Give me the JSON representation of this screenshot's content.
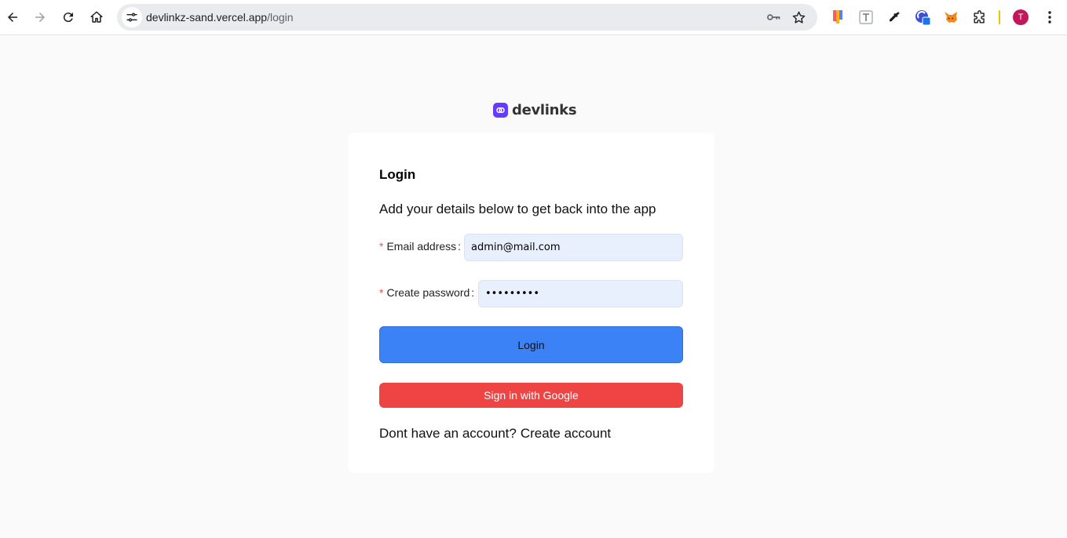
{
  "browser": {
    "url_host": "devlinkz-sand.vercel.app",
    "url_path": "/login",
    "profile_initial": "T",
    "icons": {
      "back": "arrow-left-icon",
      "forward": "arrow-right-icon",
      "reload": "reload-icon",
      "home": "home-icon",
      "site_info": "tune-icon",
      "password": "key-icon",
      "bookmark": "star-icon",
      "menu": "three-dots-vertical-icon"
    },
    "extensions": [
      "colorful-extension-icon",
      "text-t-extension-icon",
      "eyedropper-icon",
      "blue-circle-extension-icon",
      "metamask-fox-icon",
      "puzzle-piece-icon"
    ],
    "colors": {
      "avatar": "#c2185b",
      "divider": "#f2c200"
    }
  },
  "brand": {
    "name": "devlinks",
    "color": "#633cff"
  },
  "login": {
    "title": "Login",
    "subtitle": "Add your details below to get back into the app",
    "email": {
      "required_mark": "*",
      "label": "Email address",
      "colon": ":",
      "value": "admin@mail.com"
    },
    "password": {
      "required_mark": "*",
      "label": "Create password",
      "colon": ":",
      "value": "•••••••••"
    },
    "login_button": "Login",
    "google_button": "Sign in with Google",
    "signup_prompt": "Dont have an account?",
    "signup_link": "Create account",
    "colors": {
      "login_button": "#3b82f6",
      "google_button": "#ef4444",
      "input_bg": "#e8f0fe",
      "required_mark": "#ff4d4f"
    }
  }
}
